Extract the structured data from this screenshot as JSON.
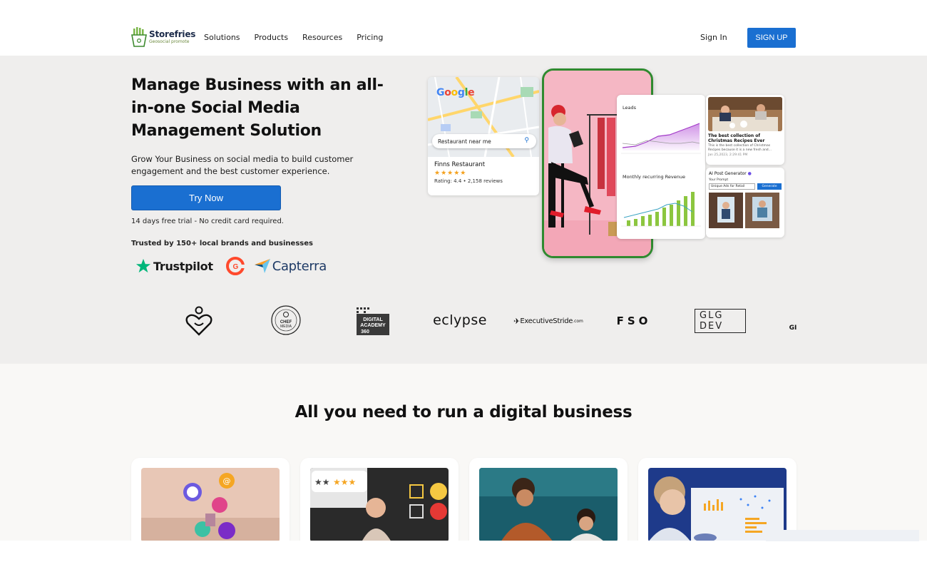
{
  "nav": {
    "logo_name": "Storefries",
    "logo_tagline": "Geosocial promote",
    "links": [
      "Solutions",
      "Products",
      "Resources",
      "Pricing"
    ],
    "signin": "Sign In",
    "signup": "SIGN UP"
  },
  "hero": {
    "title": "Manage Business with an all-in-one Social Media Management Solution",
    "subtitle": "Grow Your Business on social media to build customer engagement and the best customer experience.",
    "cta": "Try Now",
    "trial_note": "14 days free trial - No credit card required.",
    "trusted": "Trusted by 150+ local brands and businesses",
    "badges": {
      "trustpilot": "Trustpilot",
      "capterra": "Capterra"
    }
  },
  "collage": {
    "google_logo": "Google",
    "search_text": "Restaurant near me",
    "restaurant_name": "Finns Restaurant",
    "stars": "★★★★★",
    "rating_text": "Rating: 4.4 • 2,158 reviews",
    "leads_label": "Leads",
    "mrr_label": "Monthly recurring Revenue",
    "blog_title": "The best collection of Christmas Recipes Ever",
    "blog_text": "This is the best collection of Christmas Recipes because it is a new fresh and...",
    "blog_date": "Jan 25,2023, 2:29:41 PM",
    "ai_title": "AI Post Generator",
    "ai_prompt_label": "Your Prompt",
    "ai_prompt_value": "Unique Ads for Retail",
    "ai_generate": "Generate"
  },
  "partners": {
    "eclypse": "eclypse",
    "executive": "ExecutiveStride",
    "executive_suffix": ".com",
    "fso": "FSO",
    "glg": "GLG DEV",
    "digital_academy": [
      "DIGITAL",
      "ACADEMY",
      "360"
    ],
    "chef_media": "CHEF MEDIA",
    "partial": "GI"
  },
  "section2": {
    "title": "All you need to run a digital business"
  },
  "colors": {
    "brand_blue": "#1a6fd1",
    "hero_bg": "#efeeed",
    "phone_border": "#2f8a2f",
    "logo_green": "#6c8a3e"
  }
}
